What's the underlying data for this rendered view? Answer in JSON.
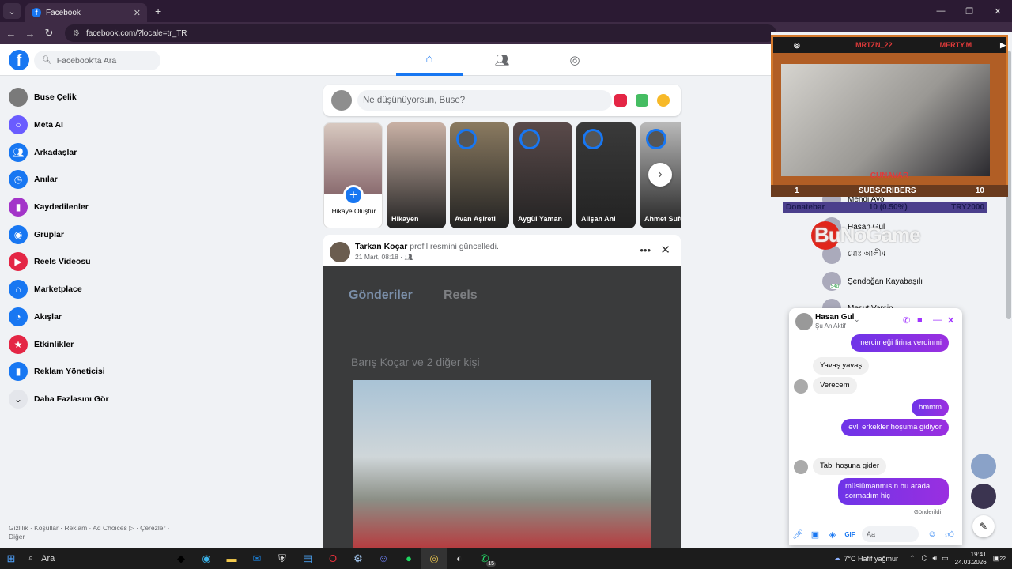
{
  "browser": {
    "tab_title": "Facebook",
    "tab_favicon": "f",
    "url": "facebook.com/?locale=tr_TR"
  },
  "header": {
    "logo": "f",
    "search_placeholder": "Facebook'ta Ara",
    "nav_icons": [
      "home-icon",
      "friends-icon",
      "groups-icon"
    ]
  },
  "sidebar": {
    "items": [
      {
        "label": "Buse Çelik",
        "icon": "avatar",
        "color": "#7a7a7a"
      },
      {
        "label": "Meta AI",
        "icon": "meta-ai-icon",
        "color": "#6a5cff"
      },
      {
        "label": "Arkadaşlar",
        "icon": "friends-icon",
        "color": "#1877f2"
      },
      {
        "label": "Anılar",
        "icon": "memories-icon",
        "color": "#1877f2"
      },
      {
        "label": "Kaydedilenler",
        "icon": "bookmark-icon",
        "color": "#a334c9"
      },
      {
        "label": "Gruplar",
        "icon": "groups-icon",
        "color": "#1877f2"
      },
      {
        "label": "Reels Videosu",
        "icon": "reels-icon",
        "color": "#e42645"
      },
      {
        "label": "Marketplace",
        "icon": "marketplace-icon",
        "color": "#1877f2"
      },
      {
        "label": "Akışlar",
        "icon": "feeds-icon",
        "color": "#1877f2"
      },
      {
        "label": "Etkinlikler",
        "icon": "events-icon",
        "color": "#e42645"
      },
      {
        "label": "Reklam Yöneticisi",
        "icon": "ads-manager-icon",
        "color": "#1877f2"
      },
      {
        "label": "Daha Fazlasını Gör",
        "icon": "chevron-down-icon",
        "color": "#e4e6eb"
      }
    ],
    "footer": "Gizlilik · Koşullar · Reklam · Ad Choices ▷ · Çerezler · Diğer"
  },
  "composer": {
    "placeholder": "Ne düşünüyorsun, Buse?"
  },
  "stories": {
    "create_label": "Hikaye Oluştur",
    "items": [
      {
        "name": "Hikayen",
        "color": "#c9b1a5"
      },
      {
        "name": "Avan Aşireti",
        "color": "#8a7a60"
      },
      {
        "name": "Aygül Yaman",
        "color": "#5a4a4a"
      },
      {
        "name": "Alişan Anl",
        "color": "#3a3a3a"
      },
      {
        "name": "Ahmet Sufu",
        "color": "#b9b9b9"
      }
    ]
  },
  "post": {
    "author": "Tarkan Koçar",
    "action": "profil resmini güncelledi.",
    "date": "21 Mart, 08:18 ·",
    "inner_tab_1": "Gönderiler",
    "inner_tab_2": "Reels",
    "inner_caption": "Barış Koçar ve 2 diğer kişi"
  },
  "stream_overlay": {
    "instagram": "MRTZN_22",
    "youtube": "MERTY.M",
    "camera_name": "CUNAVAR",
    "subs_left": "1",
    "subs_label": "SUBSCRIBERS",
    "subs_right": "10",
    "donate_label": "Donatebar",
    "donate_progress": "10 (0.50%)",
    "donate_target": "TRY2000",
    "watermark": "BuNoGame"
  },
  "contacts": [
    {
      "name": "Mehdi Ayo"
    },
    {
      "name": "Hasan Gul"
    },
    {
      "name": "মোঃ আলীম"
    },
    {
      "name": "Şendoğan Kayabaşılı"
    },
    {
      "name": "Mesut Varcin"
    }
  ],
  "contact_badge": "54d",
  "chat": {
    "name": "Hasan Gul",
    "status": "Şu An Aktif",
    "messages": [
      {
        "dir": "out",
        "text": "mercimeği firina verdinmi"
      },
      {
        "dir": "in",
        "text": "Yavaş yavaş"
      },
      {
        "dir": "in",
        "text": "Verecem"
      },
      {
        "dir": "out",
        "text": "hmmm"
      },
      {
        "dir": "out",
        "text": "evli erkekler hoşuma gidiyor"
      },
      {
        "dir": "in",
        "text": "Tabi hoşuna gider"
      },
      {
        "dir": "out",
        "text": "müslümanmısın bu arada sormadım hiç"
      }
    ],
    "seen": "Gönderildi",
    "input_placeholder": "Aa"
  },
  "taskbar": {
    "search": "Ara",
    "weather": "7°C  Hafif yağmur",
    "time": "19:41",
    "date": "24.03.2026",
    "notif": "22",
    "whatsapp_badge": "15"
  }
}
